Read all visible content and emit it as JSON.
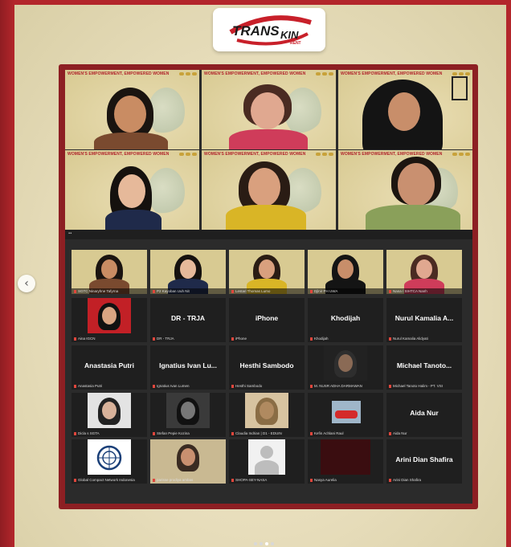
{
  "brand": {
    "line1": "TRANS",
    "line2": "KIN",
    "line3": "RENT"
  },
  "meeting": {
    "banner_title": "WOMEN'S EMPOWERMENT, EMPOWERED WOMEN"
  },
  "participants": [
    {
      "name": "",
      "label": "SGTC Ninaryhne Tafyrna"
    },
    {
      "name": "",
      "label": "P2 Kayoban Uuh Nit"
    },
    {
      "name": "",
      "label": "Lestari Thomas Lumo"
    },
    {
      "name": "",
      "label": "Djlnir PH UWA"
    },
    {
      "name": "",
      "label": "Nana / SIHTCA Nanh"
    },
    {
      "name": "",
      "label": "Aina IGCN"
    },
    {
      "name": "DR - TRJA",
      "label": "DR - TRJA"
    },
    {
      "name": "iPhone",
      "label": "iPhone"
    },
    {
      "name": "Khodijah",
      "label": "Khodijah"
    },
    {
      "name": "Nurul Kamalia A...",
      "label": "Nurul Kamalia Alidyati"
    },
    {
      "name": "Anastasia Putri",
      "label": "Anastasia Putri"
    },
    {
      "name": "Ignatius Ivan Lu...",
      "label": "Ignatius Ivan Lumen"
    },
    {
      "name": "Hesthi Sambodo",
      "label": "Hesthi Sambodo"
    },
    {
      "name": "",
      "label": "M. NUSR ADHA DARMAWAN"
    },
    {
      "name": "Michael Tanoto...",
      "label": "Michael Tanoto Halim - PT. VSI"
    },
    {
      "name": "",
      "label": "Dicla s SGTA"
    },
    {
      "name": "",
      "label": "Stefan Pepie Kozina"
    },
    {
      "name": "",
      "label": "Claudia Indrian | D1 - EDUIN"
    },
    {
      "name": "",
      "label": "Kefin Achlani Raul"
    },
    {
      "name": "Aida Nur",
      "label": "Aida Nur"
    },
    {
      "name": "",
      "label": "Global Compact Network Indonesia"
    },
    {
      "name": "",
      "label": "parisse prodiya ambas"
    },
    {
      "name": "",
      "label": "SHOPA-SEY-NASA"
    },
    {
      "name": "",
      "label": "Nasya Aurelia"
    },
    {
      "name": "Arini Dian Shafira",
      "label": "Arini Dian Shafira"
    }
  ],
  "icons": {
    "carousel_prev": "chevron-left-icon",
    "un_global_compact": "un-emblem-icon"
  },
  "colors": {
    "background_red": "#b3262b",
    "frame_red": "#8d1f23",
    "tile_dark": "#1f1f1f",
    "poster_cream": "#efe6c8"
  }
}
